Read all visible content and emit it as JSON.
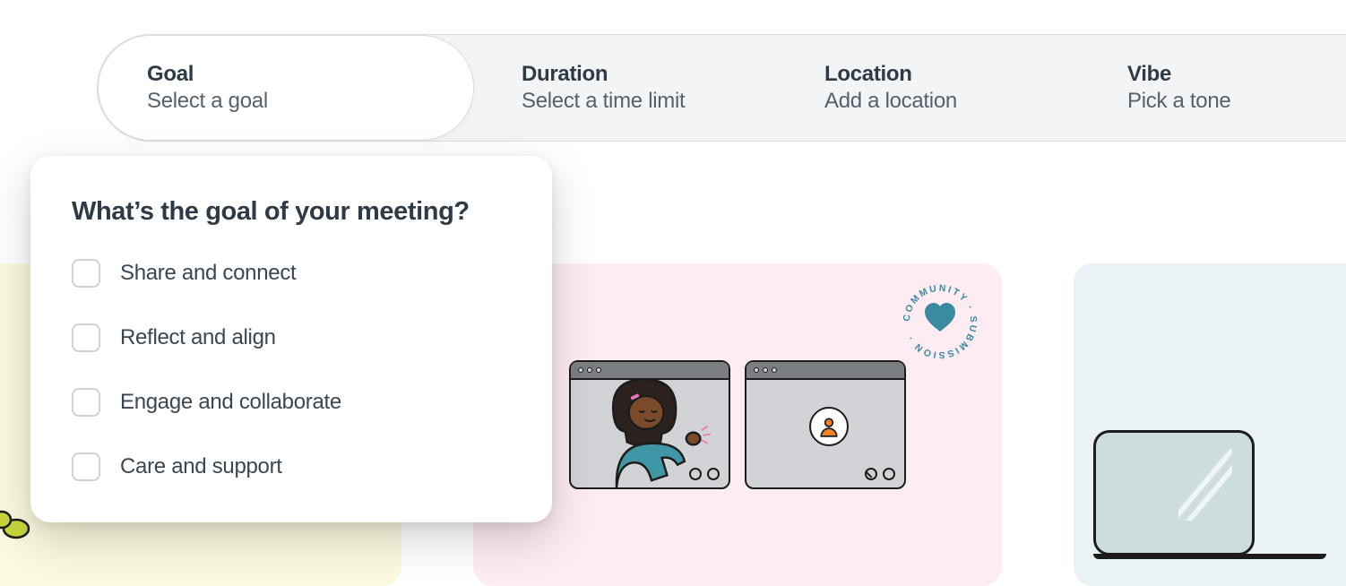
{
  "tabs": [
    {
      "title": "Goal",
      "sub": "Select a goal"
    },
    {
      "title": "Duration",
      "sub": "Select a time limit"
    },
    {
      "title": "Location",
      "sub": "Add a location"
    },
    {
      "title": "Vibe",
      "sub": "Pick a tone"
    }
  ],
  "popover": {
    "heading": "What’s the goal of your meeting?",
    "options": [
      "Share and connect",
      "Reflect and align",
      "Engage and collaborate",
      "Care and support"
    ]
  },
  "badge_text": "COMMUNITY · SUBMISSION ·"
}
